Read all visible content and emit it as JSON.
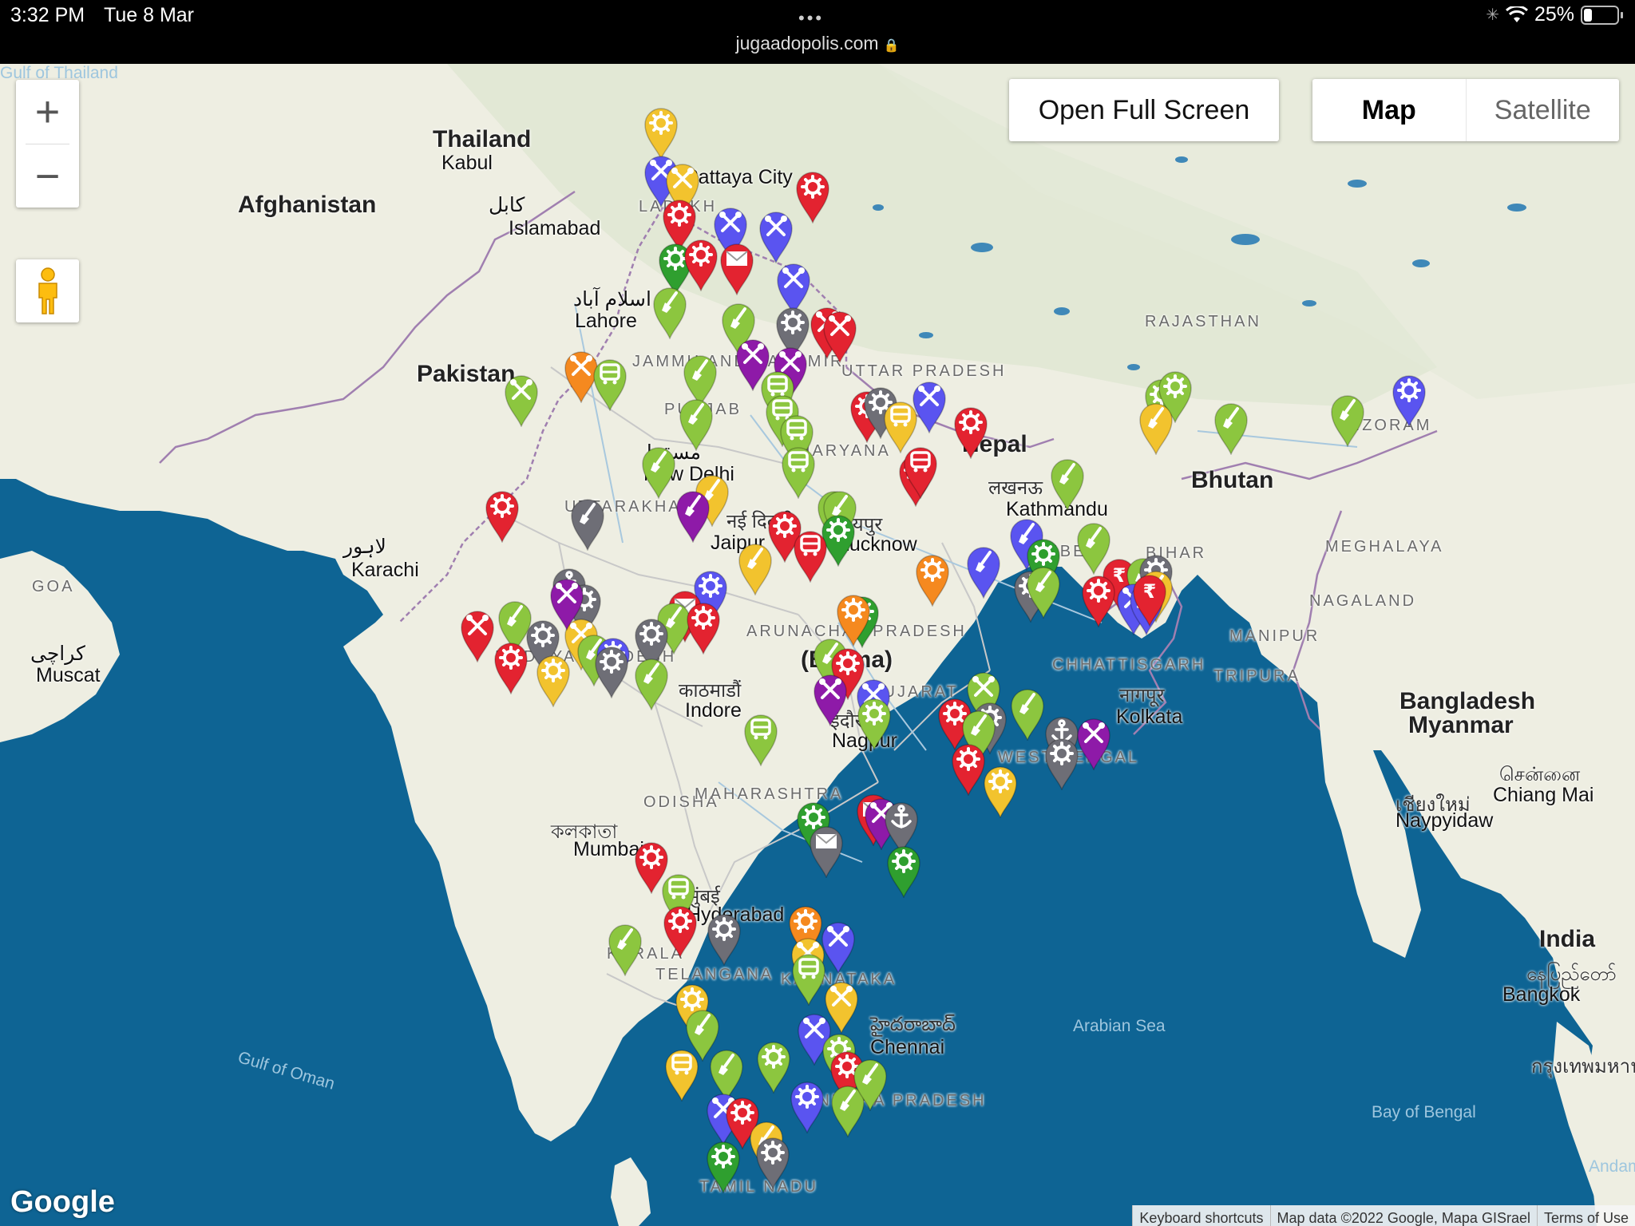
{
  "status": {
    "time": "3:32 PM",
    "date": "Tue 8 Mar",
    "url": "jugaadopolis.com",
    "battery": "25%",
    "battery_level": 0.25
  },
  "controls": {
    "zoom_in": "+",
    "zoom_out": "−",
    "fullscreen": "Open Full Screen",
    "map_type_active": "Map",
    "map_type_inactive": "Satellite"
  },
  "labels": [
    {
      "t": "Afghanistan",
      "c": "country"
    },
    {
      "t": "Pakistan",
      "c": "country"
    },
    {
      "t": "Nepal",
      "c": "country"
    },
    {
      "t": "Bhutan",
      "c": "country"
    },
    {
      "t": "Bangladesh",
      "c": "country"
    },
    {
      "t": "Myanmar",
      "c": "country"
    },
    {
      "t": "(Burma)",
      "c": "country"
    },
    {
      "t": "India",
      "c": "country"
    },
    {
      "t": "Thailand",
      "c": "country"
    },
    {
      "t": "Kabul",
      "c": "city"
    },
    {
      "t": "کابل",
      "c": "city"
    },
    {
      "t": "Islamabad",
      "c": "city"
    },
    {
      "t": "اسلام آباد",
      "c": "city"
    },
    {
      "t": "Lahore",
      "c": "city"
    },
    {
      "t": "لاہور",
      "c": "city"
    },
    {
      "t": "Karachi",
      "c": "city"
    },
    {
      "t": "کراچی",
      "c": "city"
    },
    {
      "t": "Muscat",
      "c": "city"
    },
    {
      "t": "مسقط",
      "c": "city"
    },
    {
      "t": "New Delhi",
      "c": "city"
    },
    {
      "t": "नई दिल्ली",
      "c": "dev"
    },
    {
      "t": "Jaipur",
      "c": "city"
    },
    {
      "t": "जयपुर",
      "c": "dev"
    },
    {
      "t": "Lucknow",
      "c": "city"
    },
    {
      "t": "लखनऊ",
      "c": "dev"
    },
    {
      "t": "Kathmandu",
      "c": "city"
    },
    {
      "t": "काठमाडौं",
      "c": "dev"
    },
    {
      "t": "Indore",
      "c": "city"
    },
    {
      "t": "इंदौर",
      "c": "dev"
    },
    {
      "t": "Nagpur",
      "c": "city"
    },
    {
      "t": "नागपूर",
      "c": "dev"
    },
    {
      "t": "Kolkata",
      "c": "city"
    },
    {
      "t": "কলকাতা",
      "c": "dev"
    },
    {
      "t": "Mumbai",
      "c": "city"
    },
    {
      "t": "मुंबई",
      "c": "dev"
    },
    {
      "t": "Hyderabad",
      "c": "city"
    },
    {
      "t": "హైదరాబాద్",
      "c": "dev"
    },
    {
      "t": "Chennai",
      "c": "city"
    },
    {
      "t": "சென்னை",
      "c": "dev"
    },
    {
      "t": "Chiang Mai",
      "c": "city"
    },
    {
      "t": "เชียงใหม่",
      "c": "dev"
    },
    {
      "t": "Naypyidaw",
      "c": "city"
    },
    {
      "t": "နေပြည်တော်",
      "c": "dev"
    },
    {
      "t": "Bangkok",
      "c": "city"
    },
    {
      "t": "กรุงเทพมหานคร",
      "c": "dev"
    },
    {
      "t": "Pattaya City",
      "c": "city"
    },
    {
      "t": "LADAKH",
      "c": "region"
    },
    {
      "t": "JAMMU AND KASHMIR",
      "c": "region"
    },
    {
      "t": "PUNJAB",
      "c": "region"
    },
    {
      "t": "HARYANA",
      "c": "region"
    },
    {
      "t": "UTTAR PRADESH",
      "c": "region"
    },
    {
      "t": "UTTARAKHAND",
      "c": "region"
    },
    {
      "t": "RAJASTHAN",
      "c": "region"
    },
    {
      "t": "TIBET",
      "c": "region"
    },
    {
      "t": "BIHAR",
      "c": "region"
    },
    {
      "t": "MEGHALAYA",
      "c": "region"
    },
    {
      "t": "NAGALAND",
      "c": "region"
    },
    {
      "t": "MANIPUR",
      "c": "region"
    },
    {
      "t": "TRIPURA",
      "c": "region"
    },
    {
      "t": "MIZORAM",
      "c": "region"
    },
    {
      "t": "ARUNACHAL PRADESH",
      "c": "region"
    },
    {
      "t": "MADHYA PRADESH",
      "c": "region"
    },
    {
      "t": "GUJARAT",
      "c": "region"
    },
    {
      "t": "CHHATTISGARH",
      "c": "region"
    },
    {
      "t": "WEST BENGAL",
      "c": "region"
    },
    {
      "t": "ODISHA",
      "c": "region"
    },
    {
      "t": "MAHARASHTRA",
      "c": "region"
    },
    {
      "t": "TELANGANA",
      "c": "region"
    },
    {
      "t": "KARNATAKA",
      "c": "region"
    },
    {
      "t": "ANDHRA PRADESH",
      "c": "region"
    },
    {
      "t": "TAMIL NADU",
      "c": "region"
    },
    {
      "t": "KERALA",
      "c": "region"
    },
    {
      "t": "GOA",
      "c": "region"
    },
    {
      "t": "Gulf of Oman",
      "c": "sea"
    },
    {
      "t": "Arabian Sea",
      "c": "sea"
    },
    {
      "t": "Bay of Bengal",
      "c": "sea"
    },
    {
      "t": "Andaman Sea",
      "c": "sea"
    },
    {
      "t": "Gulf of Thailand",
      "c": "sea"
    }
  ],
  "pins": [
    {
      "color": "#f2c32e",
      "icon": "gear-icon"
    },
    {
      "color": "#5a54f0",
      "icon": "tools-icon"
    },
    {
      "color": "#f2c32e",
      "icon": "tools-icon"
    },
    {
      "color": "#e32330",
      "icon": "gear-icon"
    },
    {
      "color": "#e32330",
      "icon": "gear-icon"
    },
    {
      "color": "#5a54f0",
      "icon": "tools-icon"
    },
    {
      "color": "#5a54f0",
      "icon": "tools-icon"
    },
    {
      "color": "#2f9f2f",
      "icon": "gear-icon"
    },
    {
      "color": "#e32330",
      "icon": "gear-icon"
    },
    {
      "color": "#e32330",
      "icon": "mail-icon"
    },
    {
      "color": "#5a54f0",
      "icon": "tools-icon"
    },
    {
      "color": "#8cc63f",
      "icon": "shovel-icon"
    },
    {
      "color": "#8cc63f",
      "icon": "shovel-icon"
    },
    {
      "color": "#6e6e76",
      "icon": "gear-icon"
    },
    {
      "color": "#e32330",
      "icon": "tools-icon"
    },
    {
      "color": "#e32330",
      "icon": "tools-icon"
    },
    {
      "color": "#f5891f",
      "icon": "tools-icon"
    },
    {
      "color": "#8cc63f",
      "icon": "train-icon"
    },
    {
      "color": "#8e1aa8",
      "icon": "tools-icon"
    },
    {
      "color": "#8e1aa8",
      "icon": "tools-icon"
    },
    {
      "color": "#8cc63f",
      "icon": "shovel-icon"
    },
    {
      "color": "#8cc63f",
      "icon": "tools-icon"
    },
    {
      "color": "#8cc63f",
      "icon": "train-icon"
    },
    {
      "color": "#8cc63f",
      "icon": "train-icon"
    },
    {
      "color": "#8cc63f",
      "icon": "train-icon"
    },
    {
      "color": "#e32330",
      "icon": "gear-icon"
    },
    {
      "color": "#6e6e76",
      "icon": "gear-icon"
    },
    {
      "color": "#e32330",
      "icon": "gear-icon"
    },
    {
      "color": "#5a54f0",
      "icon": "tools-icon"
    },
    {
      "color": "#f2c32e",
      "icon": "train-icon"
    },
    {
      "color": "#8cc63f",
      "icon": "shovel-icon"
    },
    {
      "color": "#8cc63f",
      "icon": "gear-icon"
    },
    {
      "color": "#8cc63f",
      "icon": "gear-icon"
    },
    {
      "color": "#5a54f0",
      "icon": "gear-icon"
    },
    {
      "color": "#f2c32e",
      "icon": "shovel-icon"
    },
    {
      "color": "#8cc63f",
      "icon": "shovel-icon"
    },
    {
      "color": "#8cc63f",
      "icon": "shovel-icon"
    },
    {
      "color": "#e32330",
      "icon": "gear-icon"
    },
    {
      "color": "#e32330",
      "icon": "train-icon"
    },
    {
      "color": "#8cc63f",
      "icon": "shovel-icon"
    },
    {
      "color": "#8cc63f",
      "icon": "train-icon"
    },
    {
      "color": "#8cc63f",
      "icon": "shovel-icon"
    },
    {
      "color": "#8cc63f",
      "icon": "shovel-icon"
    },
    {
      "color": "#e32330",
      "icon": "gear-icon"
    },
    {
      "color": "#6e6e76",
      "icon": "shovel-icon"
    },
    {
      "color": "#f2c32e",
      "icon": "shovel-icon"
    },
    {
      "color": "#e32330",
      "icon": "gear-icon"
    },
    {
      "color": "#8e1aa8",
      "icon": "shovel-icon"
    },
    {
      "color": "#8cc63f",
      "icon": "shovel-icon"
    },
    {
      "color": "#2f9f2f",
      "icon": "gear-icon"
    },
    {
      "color": "#5a54f0",
      "icon": "shovel-icon"
    },
    {
      "color": "#2f9f2f",
      "icon": "gear-icon"
    },
    {
      "color": "#8cc63f",
      "icon": "shovel-icon"
    },
    {
      "color": "#e32330",
      "icon": "rupee-icon"
    },
    {
      "color": "#8cc63f",
      "icon": "shovel-icon"
    },
    {
      "color": "#6e6e76",
      "icon": "gear-icon"
    },
    {
      "color": "#f2c32e",
      "icon": "shovel-icon"
    },
    {
      "color": "#5a54f0",
      "icon": "tools-icon"
    },
    {
      "color": "#5a54f0",
      "icon": "tools-icon"
    },
    {
      "color": "#f5891f",
      "icon": "gear-icon"
    },
    {
      "color": "#5a54f0",
      "icon": "shovel-icon"
    },
    {
      "color": "#6e6e76",
      "icon": "gear-icon"
    },
    {
      "color": "#8cc63f",
      "icon": "shovel-icon"
    },
    {
      "color": "#e32330",
      "icon": "gear-icon"
    },
    {
      "color": "#e32330",
      "icon": "rupee-icon"
    },
    {
      "color": "#e32330",
      "icon": "train-icon"
    },
    {
      "color": "#5a54f0",
      "icon": "gear-icon"
    },
    {
      "color": "#e32330",
      "icon": "mail-icon"
    },
    {
      "color": "#f2c32e",
      "icon": "shovel-icon"
    },
    {
      "color": "#8cc63f",
      "icon": "shovel-icon"
    },
    {
      "color": "#e32330",
      "icon": "gear-icon"
    },
    {
      "color": "#2f9f2f",
      "icon": "gear-icon"
    },
    {
      "color": "#f5891f",
      "icon": "gear-icon"
    },
    {
      "color": "#6e6e76",
      "icon": "anchor-icon"
    },
    {
      "color": "#6e6e76",
      "icon": "gear-icon"
    },
    {
      "color": "#f2c32e",
      "icon": "tools-icon"
    },
    {
      "color": "#6e6e76",
      "icon": "gear-icon"
    },
    {
      "color": "#8cc63f",
      "icon": "shovel-icon"
    },
    {
      "color": "#8e1aa8",
      "icon": "tools-icon"
    },
    {
      "color": "#8cc63f",
      "icon": "shovel-icon"
    },
    {
      "color": "#e32330",
      "icon": "tools-icon"
    },
    {
      "color": "#5a54f0",
      "icon": "gear-icon"
    },
    {
      "color": "#6e6e76",
      "icon": "gear-icon"
    },
    {
      "color": "#e32330",
      "icon": "gear-icon"
    },
    {
      "color": "#6e6e76",
      "icon": "gear-icon"
    },
    {
      "color": "#8cc63f",
      "icon": "shovel-icon"
    },
    {
      "color": "#f2c32e",
      "icon": "gear-icon"
    },
    {
      "color": "#8cc63f",
      "icon": "shovel-icon"
    },
    {
      "color": "#e32330",
      "icon": "gear-icon"
    },
    {
      "color": "#8e1aa8",
      "icon": "tools-icon"
    },
    {
      "color": "#5a54f0",
      "icon": "tools-icon"
    },
    {
      "color": "#8cc63f",
      "icon": "gear-icon"
    },
    {
      "color": "#8cc63f",
      "icon": "tools-icon"
    },
    {
      "color": "#6e6e76",
      "icon": "gear-icon"
    },
    {
      "color": "#e32330",
      "icon": "gear-icon"
    },
    {
      "color": "#8cc63f",
      "icon": "shovel-icon"
    },
    {
      "color": "#8cc63f",
      "icon": "shovel-icon"
    },
    {
      "color": "#6e6e76",
      "icon": "anchor-icon"
    },
    {
      "color": "#8e1aa8",
      "icon": "tools-icon"
    },
    {
      "color": "#8cc63f",
      "icon": "train-icon"
    },
    {
      "color": "#6e6e76",
      "icon": "gear-icon"
    },
    {
      "color": "#e32330",
      "icon": "gear-icon"
    },
    {
      "color": "#f2c32e",
      "icon": "gear-icon"
    },
    {
      "color": "#e32330",
      "icon": "mail-icon"
    },
    {
      "color": "#2f9f2f",
      "icon": "gear-icon"
    },
    {
      "color": "#8e1aa8",
      "icon": "tools-icon"
    },
    {
      "color": "#6e6e76",
      "icon": "anchor-icon"
    },
    {
      "color": "#6e6e76",
      "icon": "mail-icon"
    },
    {
      "color": "#2f9f2f",
      "icon": "gear-icon"
    },
    {
      "color": "#e32330",
      "icon": "gear-icon"
    },
    {
      "color": "#8cc63f",
      "icon": "train-icon"
    },
    {
      "color": "#e32330",
      "icon": "gear-icon"
    },
    {
      "color": "#6e6e76",
      "icon": "gear-icon"
    },
    {
      "color": "#8cc63f",
      "icon": "shovel-icon"
    },
    {
      "color": "#f5891f",
      "icon": "gear-icon"
    },
    {
      "color": "#5a54f0",
      "icon": "tools-icon"
    },
    {
      "color": "#f2c32e",
      "icon": "tools-icon"
    },
    {
      "color": "#8cc63f",
      "icon": "train-icon"
    },
    {
      "color": "#f2c32e",
      "icon": "tools-icon"
    },
    {
      "color": "#f2c32e",
      "icon": "gear-icon"
    },
    {
      "color": "#8cc63f",
      "icon": "shovel-icon"
    },
    {
      "color": "#5a54f0",
      "icon": "tools-icon"
    },
    {
      "color": "#f2c32e",
      "icon": "train-icon"
    },
    {
      "color": "#8cc63f",
      "icon": "shovel-icon"
    },
    {
      "color": "#8cc63f",
      "icon": "gear-icon"
    },
    {
      "color": "#8cc63f",
      "icon": "gear-icon"
    },
    {
      "color": "#e32330",
      "icon": "gear-icon"
    },
    {
      "color": "#5a54f0",
      "icon": "tools-icon"
    },
    {
      "color": "#e32330",
      "icon": "gear-icon"
    },
    {
      "color": "#5a54f0",
      "icon": "gear-icon"
    },
    {
      "color": "#8cc63f",
      "icon": "shovel-icon"
    },
    {
      "color": "#8cc63f",
      "icon": "shovel-icon"
    },
    {
      "color": "#f2c32e",
      "icon": "shovel-icon"
    },
    {
      "color": "#6e6e76",
      "icon": "gear-icon"
    },
    {
      "color": "#2f9f2f",
      "icon": "gear-icon"
    }
  ],
  "footer": {
    "google": "Google",
    "shortcuts": "Keyboard shortcuts",
    "mapdata": "Map data ©2022 Google, Mapa GISrael",
    "terms": "Terms of Use"
  }
}
